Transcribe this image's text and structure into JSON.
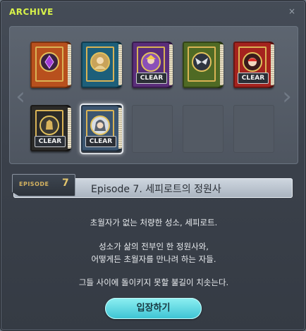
{
  "window": {
    "title": "ARCHIVE",
    "close_symbol": "×"
  },
  "nav": {
    "prev_symbol": "‹",
    "next_symbol": "›"
  },
  "books": [
    {
      "color": "#b8501d",
      "emblem": "purple-gem",
      "cleared": false
    },
    {
      "color": "#1d5f7a",
      "emblem": "portrait",
      "cleared": false
    },
    {
      "color": "#5a2d7a",
      "emblem": "character",
      "cleared": true
    },
    {
      "color": "#4f6a24",
      "emblem": "wings",
      "cleared": false
    },
    {
      "color": "#a5231e",
      "emblem": "red-hair-character",
      "cleared": true
    },
    {
      "color": "#2b2a28",
      "emblem": "lion-crest",
      "cleared": true
    },
    {
      "color": "#3b5570",
      "emblem": "hooded-character",
      "cleared": true
    }
  ],
  "badge_label": "CLEAR",
  "episode": {
    "tag_word": "EPISODE",
    "number": "7",
    "title": "Episode 7. 세피로트의 정원사",
    "line1": "초월자가 없는 처량한 성소, 세피로트.",
    "line2": "성소가 삶의 전부인 한 정원사와,",
    "line3": "어떻게든 초월자를 만나려 하는 자들.",
    "line4": "그들 사이에 돌이키지 못할 불길이 치솟는다."
  },
  "enter_button": "입장하기"
}
